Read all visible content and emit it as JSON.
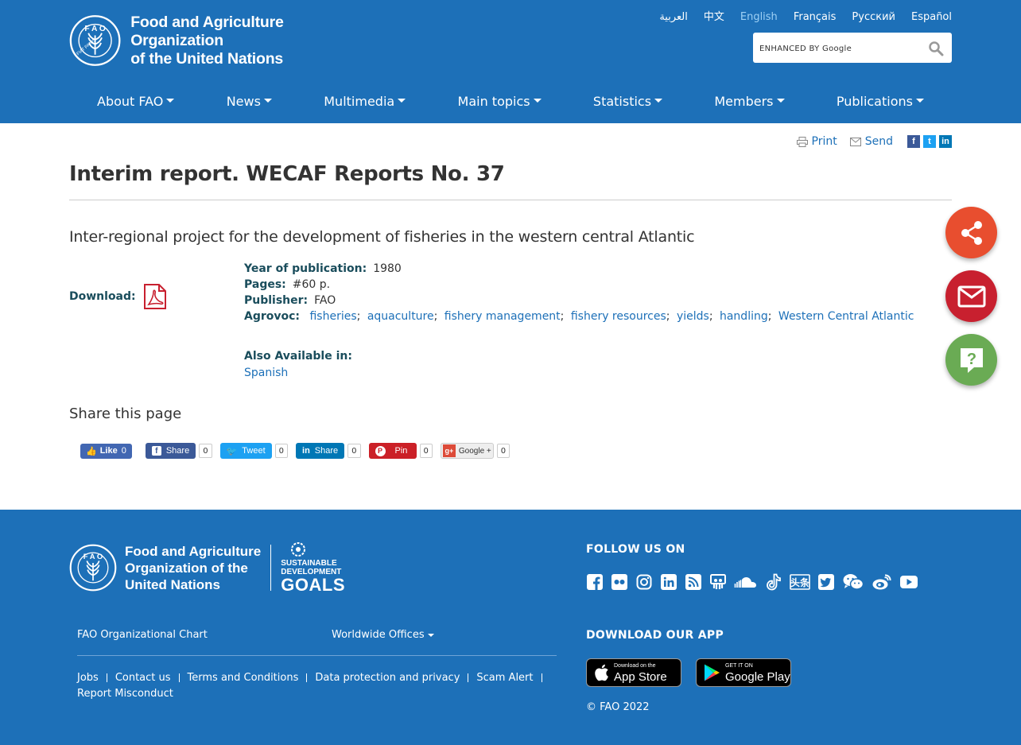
{
  "header": {
    "logo_lines": [
      "Food and Agriculture Organization",
      "of the United Nations"
    ],
    "emblem_text": "FIAT PANIS",
    "languages": [
      {
        "label": "العربية",
        "active": false
      },
      {
        "label": "中文",
        "active": false
      },
      {
        "label": "English",
        "active": true
      },
      {
        "label": "Français",
        "active": false
      },
      {
        "label": "Русский",
        "active": false
      },
      {
        "label": "Español",
        "active": false
      }
    ],
    "search_placeholder": "ENHANCED BY Google",
    "nav": [
      "About FAO",
      "News",
      "Multimedia",
      "Main topics",
      "Statistics",
      "Members",
      "Publications"
    ]
  },
  "tools": {
    "print": "Print",
    "send": "Send"
  },
  "main": {
    "title": "Interim report. WECAF Reports No. 37",
    "subtitle": "Inter-regional project for the development of fisheries in the western central Atlantic",
    "download_label": "Download:",
    "meta": {
      "year_label": "Year of publication:",
      "year": "1980",
      "pages_label": "Pages:",
      "pages": "#60 p.",
      "publisher_label": "Publisher:",
      "publisher": "FAO",
      "agrovoc_label": "Agrovoc:",
      "agrovoc": [
        "fisheries",
        "aquaculture",
        "fishery management",
        "fishery resources",
        "yields",
        "handling",
        "Western Central Atlantic"
      ]
    },
    "also_label": "Also Available in:",
    "also_link": "Spanish"
  },
  "share": {
    "title": "Share this page",
    "fb_like": "Like",
    "fb_like_count": "0",
    "buttons": [
      {
        "label": "Share",
        "count": "0",
        "color": "#3b5998"
      },
      {
        "label": "Tweet",
        "count": "0",
        "color": "#1da1f2"
      },
      {
        "label": "Share",
        "count": "0",
        "color": "#0077b5"
      },
      {
        "label": "Pin",
        "count": "0",
        "color": "#cb2027"
      },
      {
        "label": "Google +",
        "count": "0",
        "color": "#eeeeee"
      }
    ]
  },
  "floating": {
    "share_color": "#e84e2f",
    "mail_color": "#c8202f",
    "help_color": "#6aab54"
  },
  "footer": {
    "logo_lines": [
      "Food and Agriculture",
      "Organization of the",
      "United Nations"
    ],
    "sdg_lines": [
      "SUSTAINABLE",
      "DEVELOPMENT",
      "GOALS"
    ],
    "org_chart": "FAO Organizational Chart",
    "worldwide": "Worldwide Offices",
    "links": [
      "Jobs",
      "Contact us",
      "Terms and Conditions",
      "Data protection and privacy",
      "Scam Alert",
      "Report Misconduct"
    ],
    "follow_title": "FOLLOW US ON",
    "follow_icons": [
      "facebook-icon",
      "flickr-icon",
      "instagram-icon",
      "linkedin-icon",
      "rss-icon",
      "slideshare-icon",
      "soundcloud-icon",
      "tiktok-icon",
      "toutiao-icon",
      "twitter-icon",
      "wechat-icon",
      "weibo-icon",
      "youtube-icon"
    ],
    "app_title": "DOWNLOAD OUR APP",
    "app_store": {
      "small": "Download on the",
      "big": "App Store"
    },
    "google_play": {
      "small": "GET IT ON",
      "big": "Google Play"
    },
    "copyright": "© FAO 2022"
  },
  "colors": {
    "brand_blue": "#1d70b8",
    "dark_teal": "#1a4d5c"
  }
}
